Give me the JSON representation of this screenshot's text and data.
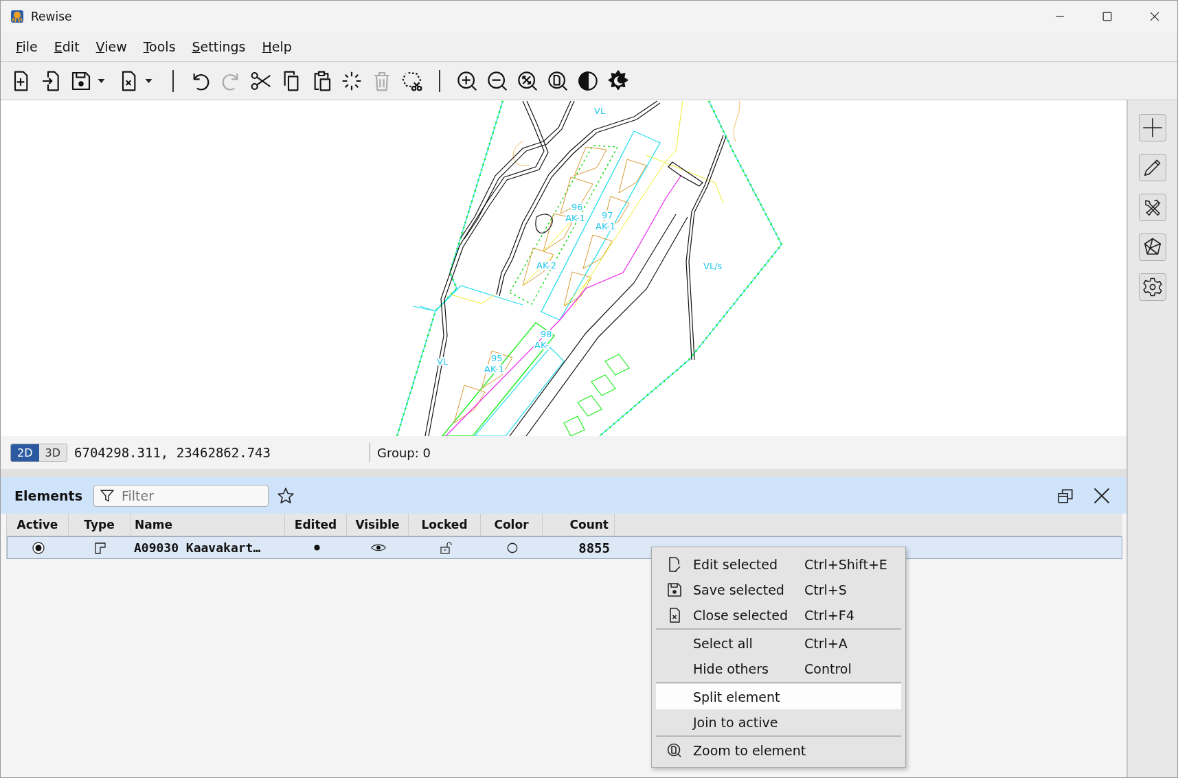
{
  "window": {
    "title": "Rewise"
  },
  "menu": [
    "File",
    "Edit",
    "View",
    "Tools",
    "Settings",
    "Help"
  ],
  "toolbar": [
    {
      "kind": "button",
      "disabled": false
    },
    {
      "kind": "button",
      "disabled": false
    },
    {
      "kind": "split",
      "disabled": false
    },
    {
      "kind": "split",
      "disabled": false
    },
    {
      "kind": "separator"
    },
    {
      "kind": "button",
      "disabled": false
    },
    {
      "kind": "button",
      "disabled": true
    },
    {
      "kind": "button",
      "disabled": false
    },
    {
      "kind": "button",
      "disabled": false
    },
    {
      "kind": "button",
      "disabled": false
    },
    {
      "kind": "button",
      "disabled": false
    },
    {
      "kind": "button",
      "disabled": true
    },
    {
      "kind": "button",
      "disabled": false
    },
    {
      "kind": "separator"
    },
    {
      "kind": "button",
      "disabled": false
    },
    {
      "kind": "button",
      "disabled": false
    },
    {
      "kind": "button",
      "disabled": false
    },
    {
      "kind": "button",
      "disabled": false
    },
    {
      "kind": "button",
      "disabled": false
    },
    {
      "kind": "button",
      "disabled": false
    }
  ],
  "map": {
    "labels": [
      "VL",
      "96",
      "AK-1",
      "97",
      "AK-1",
      "AK-2",
      "VL/s",
      "98",
      "AK-",
      "95",
      "AK-1",
      "VL"
    ]
  },
  "status": {
    "view_modes": [
      {
        "label": "2D",
        "selected": true
      },
      {
        "label": "3D",
        "selected": false
      }
    ],
    "coordinates": "6704298.311, 23462862.743",
    "group": "Group: 0"
  },
  "elements_panel": {
    "title": "Elements",
    "filter": {
      "placeholder": "Filter"
    },
    "columns": [
      "Active",
      "Type",
      "Name",
      "Edited",
      "Visible",
      "Locked",
      "Color",
      "Count"
    ],
    "rows": [
      {
        "selected": true,
        "active": true,
        "name": "A09030 Kaavakart…",
        "edited": true,
        "visible": true,
        "locked": false,
        "count": "8855"
      }
    ]
  },
  "context_menu": {
    "groups": [
      [
        {
          "label": "Edit selected",
          "shortcut": "Ctrl+Shift+E",
          "highlighted": false
        },
        {
          "label": "Save selected",
          "shortcut": "Ctrl+S",
          "highlighted": false
        },
        {
          "label": "Close selected",
          "shortcut": "Ctrl+F4",
          "highlighted": false
        }
      ],
      [
        {
          "label": "Select all",
          "shortcut": "Ctrl+A",
          "highlighted": false
        },
        {
          "label": "Hide others",
          "shortcut": "Control",
          "highlighted": false
        }
      ],
      [
        {
          "label": "Split element",
          "highlighted": true
        },
        {
          "label": "Join to active",
          "highlighted": false
        }
      ],
      [
        {
          "label": "Zoom to element",
          "highlighted": false
        }
      ]
    ]
  }
}
